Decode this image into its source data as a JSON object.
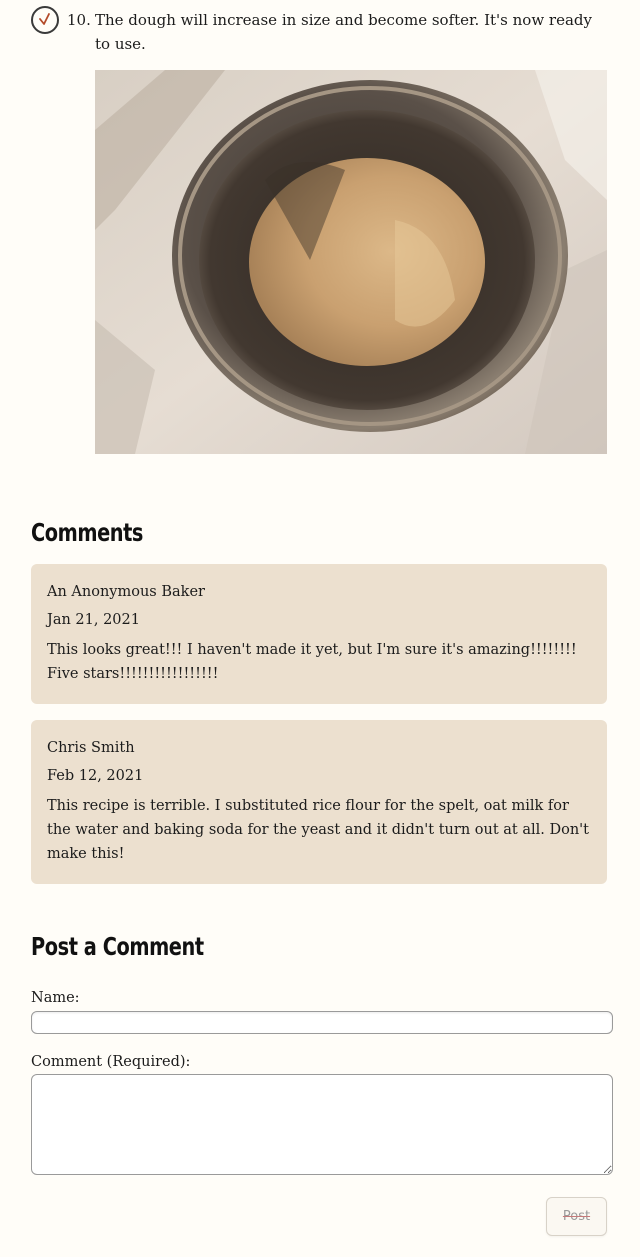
{
  "step": {
    "number": "10.",
    "text": "The dough will increase in size and become softer. It's now ready to use.",
    "completed": true,
    "icon": "check-circle-icon",
    "image_subject": "dough in a stainless steel bowl"
  },
  "comments_section": {
    "heading": "Comments",
    "card_color": "#ece0cf",
    "comments": [
      {
        "author": "An Anonymous Baker",
        "date": "Jan 21, 2021",
        "text": "This looks great!!! I haven't made it yet, but I'm sure it's amazing!!!!!!!! Five stars!!!!!!!!!!!!!!!!!"
      },
      {
        "author": "Chris Smith",
        "date": "Feb 12, 2021",
        "text": "This recipe is terrible. I substituted rice flour for the spelt, oat milk for the water and baking soda for the yeast and it didn't turn out at all. Don't make this!"
      }
    ]
  },
  "post_form": {
    "heading": "Post a Comment",
    "name_label": "Name:",
    "name_value": "",
    "comment_label": "Comment (Required):",
    "comment_value": "",
    "post_button_label": "Post",
    "post_button_enabled": false
  }
}
